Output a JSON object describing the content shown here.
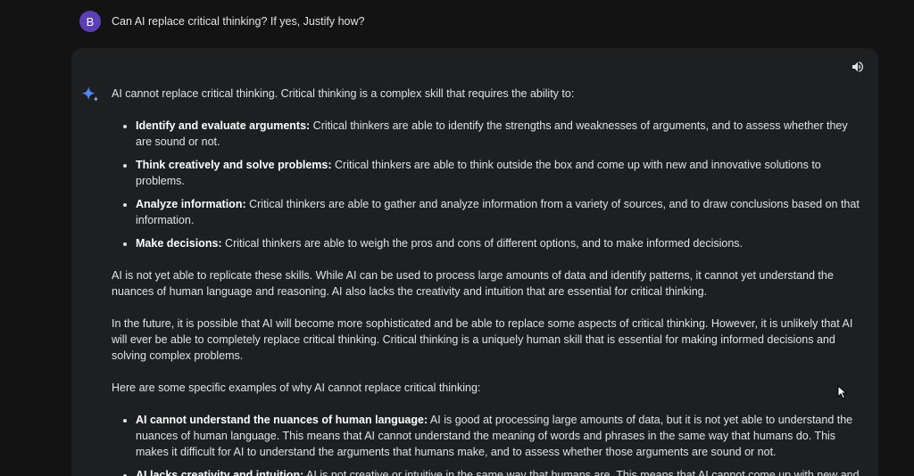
{
  "prompt": {
    "avatar_letter": "B",
    "text": "Can AI replace critical thinking? If yes, Justify how?"
  },
  "response": {
    "intro": "AI cannot replace critical thinking. Critical thinking is a complex skill that requires the ability to:",
    "skills": [
      {
        "title": "Identify and evaluate arguments:",
        "text": " Critical thinkers are able to identify the strengths and weaknesses of arguments, and to assess whether they are sound or not."
      },
      {
        "title": "Think creatively and solve problems:",
        "text": " Critical thinkers are able to think outside the box and come up with new and innovative solutions to problems."
      },
      {
        "title": "Analyze information:",
        "text": " Critical thinkers are able to gather and analyze information from a variety of sources, and to draw conclusions based on that information."
      },
      {
        "title": "Make decisions:",
        "text": " Critical thinkers are able to weigh the pros and cons of different options, and to make informed decisions."
      }
    ],
    "paragraph1": "AI is not yet able to replicate these skills. While AI can be used to process large amounts of data and identify patterns, it cannot yet understand the nuances of human language and reasoning. AI also lacks the creativity and intuition that are essential for critical thinking.",
    "paragraph2": "In the future, it is possible that AI will become more sophisticated and be able to replace some aspects of critical thinking. However, it is unlikely that AI will ever be able to completely replace critical thinking. Critical thinking is a uniquely human skill that is essential for making informed decisions and solving complex problems.",
    "paragraph3": "Here are some specific examples of why AI cannot replace critical thinking:",
    "examples": [
      {
        "title": "AI cannot understand the nuances of human language:",
        "text": " AI is good at processing large amounts of data, but it is not yet able to understand the nuances of human language. This means that AI cannot understand the meaning of words and phrases in the same way that humans do. This makes it difficult for AI to understand the arguments that humans make, and to assess whether those arguments are sound or not."
      },
      {
        "title": "AI lacks creativity and intuition:",
        "text": " AI is not creative or intuitive in the same way that humans are. This means that AI cannot come up with new and"
      }
    ]
  },
  "icons": {
    "speaker": "speaker-icon",
    "sparkle": "gemini-sparkle-icon",
    "cursor": "mouse-cursor-icon"
  },
  "colors": {
    "background": "#131314",
    "card": "#1e1f20",
    "avatar": "#5b3fb5",
    "sparkle": "#4e86f7"
  }
}
